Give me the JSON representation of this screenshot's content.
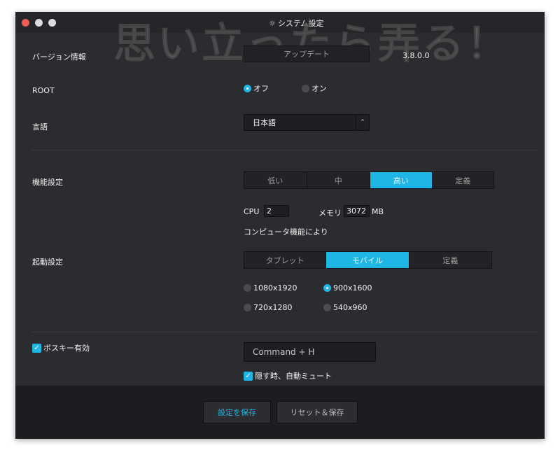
{
  "window": {
    "title": "システム設定",
    "title_icon": "gear-icon"
  },
  "watermark": "思い立ったら弄る！",
  "version": {
    "label": "バージョン情報",
    "update_button": "アップデート",
    "value": "3.8.0.0"
  },
  "root": {
    "label": "ROOT",
    "options": [
      "オフ",
      "オン"
    ],
    "selected": 0
  },
  "language": {
    "label": "言語",
    "value": "日本語"
  },
  "performance": {
    "label": "機能設定",
    "options": [
      "低い",
      "中",
      "高い",
      "定義"
    ],
    "selected": 2,
    "cpu_label": "CPU",
    "cpu_value": "2",
    "memory_label": "メモリ",
    "memory_value": "3072",
    "memory_unit": "MB",
    "note": "コンピュータ機能により"
  },
  "startup": {
    "label": "起動設定",
    "options": [
      "タブレット",
      "モバイル",
      "定義"
    ],
    "selected": 1,
    "resolutions": [
      "1080x1920",
      "900x1600",
      "720x1280",
      "540x960"
    ],
    "selected_resolution": 1
  },
  "boss_key": {
    "label": "ボスキー有効",
    "checked": true,
    "shortcut": "Command + H",
    "mute_label": "隠す時、自動ミュート",
    "mute_checked": true
  },
  "footer": {
    "save": "設定を保存",
    "reset_save": "リセット＆保存"
  },
  "colors": {
    "accent": "#1fb6e6",
    "background": "#2b2c2f",
    "close": "#ee5c55"
  }
}
